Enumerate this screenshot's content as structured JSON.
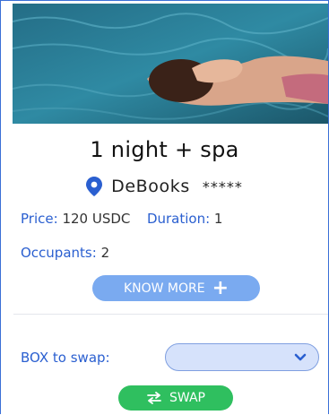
{
  "card": {
    "title": "1 night + spa",
    "location": {
      "icon": "map-pin-icon",
      "name": "DeBooks",
      "stars": "*****"
    },
    "details": {
      "price_label": "Price:",
      "price_value": "120 USDC",
      "duration_label": "Duration:",
      "duration_value": "1",
      "occupants_label": "Occupants:",
      "occupants_value": "2"
    },
    "know_more_label": "KNOW MORE",
    "know_more_icon": "plus-icon"
  },
  "swap": {
    "label": "BOX to swap:",
    "select_value": "",
    "select_icon": "chevron-down-icon",
    "button_label": "SWAP",
    "button_icon": "swap-arrows-icon"
  },
  "colors": {
    "accent": "#2a5fd0",
    "know_more_bg": "#7aaaf0",
    "swap_bg": "#2fbf5f",
    "select_bg": "#d6e2fb"
  }
}
